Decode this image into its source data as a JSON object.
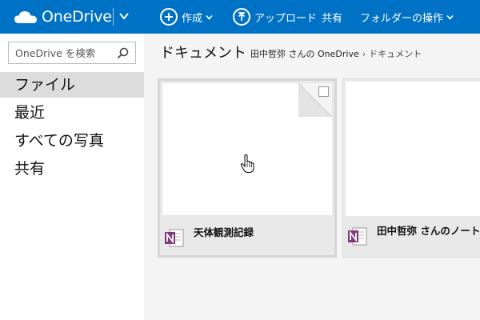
{
  "app": {
    "brand": "OneDrive",
    "colors": {
      "topbar": "#0072c6",
      "onenote": "#80397b",
      "active_nav": "#dcdcdc"
    }
  },
  "toolbar": {
    "create_label": "作成",
    "upload_label": "アップロード",
    "share_label": "共有",
    "folder_ops_label": "フォルダーの操作"
  },
  "search": {
    "placeholder": "OneDrive を検索"
  },
  "sidebar": {
    "items": [
      {
        "label": "ファイル",
        "active": true
      },
      {
        "label": "最近",
        "active": false
      },
      {
        "label": "すべての写真",
        "active": false
      },
      {
        "label": "共有",
        "active": false
      }
    ]
  },
  "main": {
    "title": "ドキュメント",
    "breadcrumb": {
      "root": "田中哲弥 さんの OneDrive",
      "separator": "›",
      "current": "ドキュメント"
    },
    "files": [
      {
        "name": "天体観測記録",
        "type": "onenote-icon"
      },
      {
        "name": "田中哲弥 さんのノート",
        "type": "onenote-icon"
      }
    ]
  }
}
